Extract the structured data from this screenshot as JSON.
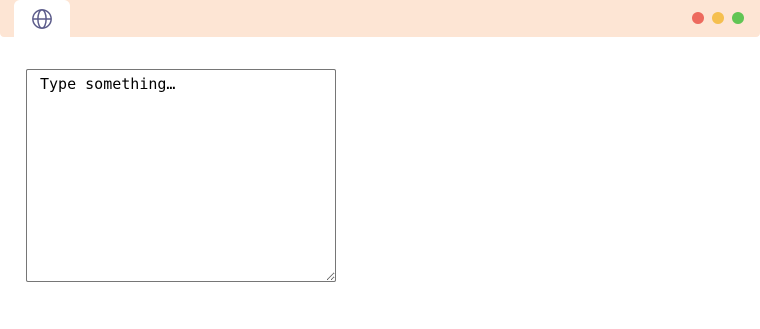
{
  "tab": {
    "icon": "globe-icon"
  },
  "window_controls": {
    "close_color": "#ed6a5e",
    "minimize_color": "#f5bf4f",
    "maximize_color": "#61c554"
  },
  "editor": {
    "value": "",
    "placeholder": "Type something…"
  },
  "colors": {
    "title_bar": "#fde5d4",
    "icon": "#5b5b8a"
  }
}
